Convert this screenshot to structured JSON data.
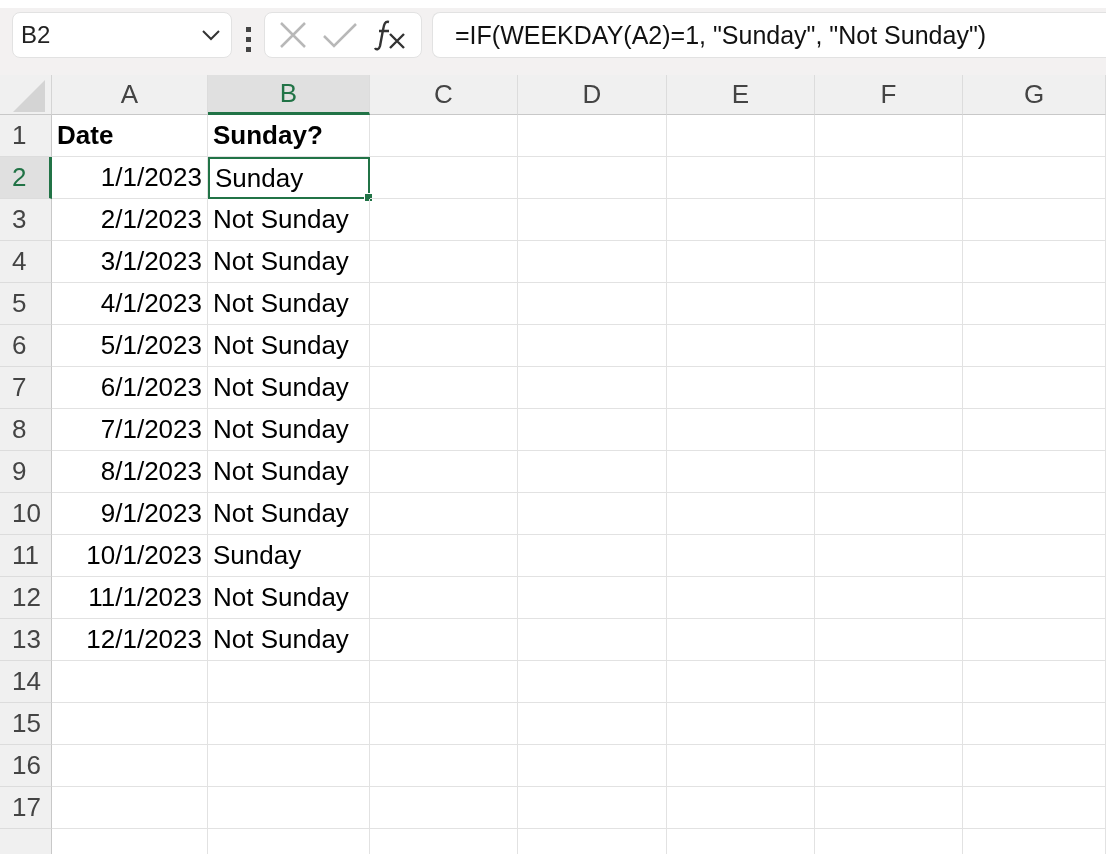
{
  "name_box": "B2",
  "formula": "=IF(WEEKDAY(A2)=1, \"Sunday\", \"Not Sunday\")",
  "columns": [
    {
      "label": "A",
      "selected": false
    },
    {
      "label": "B",
      "selected": true
    },
    {
      "label": "C",
      "selected": false
    },
    {
      "label": "D",
      "selected": false
    },
    {
      "label": "E",
      "selected": false
    },
    {
      "label": "F",
      "selected": false
    },
    {
      "label": "G",
      "selected": false
    }
  ],
  "rows": [
    {
      "number": "1",
      "selected": false,
      "cells": [
        {
          "text": "Date",
          "kind": "header"
        },
        {
          "text": "Sunday?",
          "kind": "header"
        }
      ]
    },
    {
      "number": "2",
      "selected": true,
      "cells": [
        {
          "text": "1/1/2023",
          "kind": "date"
        },
        {
          "text": "Sunday",
          "kind": "text"
        }
      ]
    },
    {
      "number": "3",
      "selected": false,
      "cells": [
        {
          "text": "2/1/2023",
          "kind": "date"
        },
        {
          "text": "Not Sunday",
          "kind": "text"
        }
      ]
    },
    {
      "number": "4",
      "selected": false,
      "cells": [
        {
          "text": "3/1/2023",
          "kind": "date"
        },
        {
          "text": "Not Sunday",
          "kind": "text"
        }
      ]
    },
    {
      "number": "5",
      "selected": false,
      "cells": [
        {
          "text": "4/1/2023",
          "kind": "date"
        },
        {
          "text": "Not Sunday",
          "kind": "text"
        }
      ]
    },
    {
      "number": "6",
      "selected": false,
      "cells": [
        {
          "text": "5/1/2023",
          "kind": "date"
        },
        {
          "text": "Not Sunday",
          "kind": "text"
        }
      ]
    },
    {
      "number": "7",
      "selected": false,
      "cells": [
        {
          "text": "6/1/2023",
          "kind": "date"
        },
        {
          "text": "Not Sunday",
          "kind": "text"
        }
      ]
    },
    {
      "number": "8",
      "selected": false,
      "cells": [
        {
          "text": "7/1/2023",
          "kind": "date"
        },
        {
          "text": "Not Sunday",
          "kind": "text"
        }
      ]
    },
    {
      "number": "9",
      "selected": false,
      "cells": [
        {
          "text": "8/1/2023",
          "kind": "date"
        },
        {
          "text": "Not Sunday",
          "kind": "text"
        }
      ]
    },
    {
      "number": "10",
      "selected": false,
      "cells": [
        {
          "text": "9/1/2023",
          "kind": "date"
        },
        {
          "text": "Not Sunday",
          "kind": "text"
        }
      ]
    },
    {
      "number": "11",
      "selected": false,
      "cells": [
        {
          "text": "10/1/2023",
          "kind": "date"
        },
        {
          "text": "Sunday",
          "kind": "text"
        }
      ]
    },
    {
      "number": "12",
      "selected": false,
      "cells": [
        {
          "text": "11/1/2023",
          "kind": "date"
        },
        {
          "text": "Not Sunday",
          "kind": "text"
        }
      ]
    },
    {
      "number": "13",
      "selected": false,
      "cells": [
        {
          "text": "12/1/2023",
          "kind": "date"
        },
        {
          "text": "Not Sunday",
          "kind": "text"
        }
      ]
    },
    {
      "number": "14",
      "selected": false
    },
    {
      "number": "15",
      "selected": false
    },
    {
      "number": "16",
      "selected": false
    },
    {
      "number": "17",
      "selected": false
    }
  ]
}
